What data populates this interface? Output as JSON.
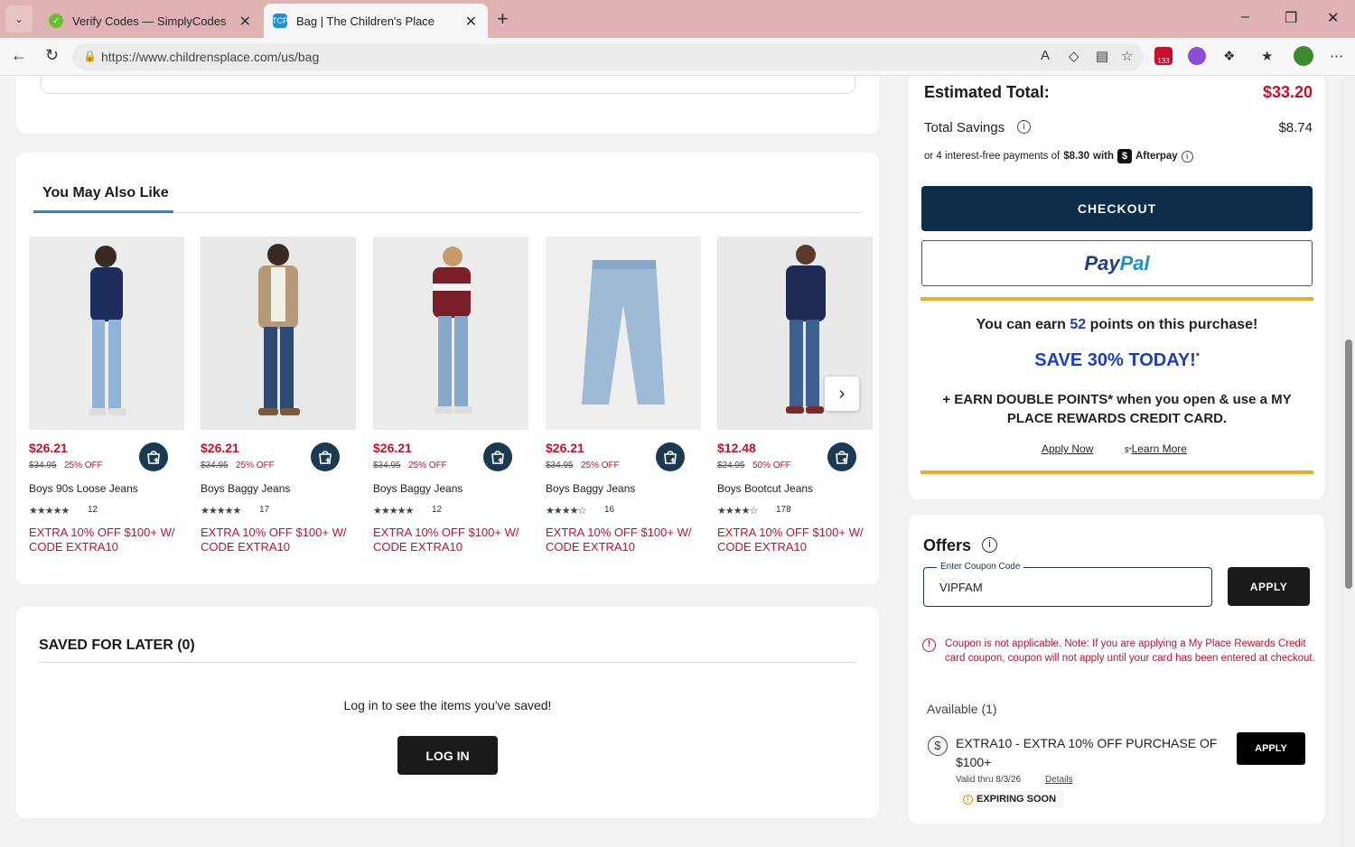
{
  "browser": {
    "tabs": [
      {
        "title": "Verify Codes — SimplyCodes",
        "active": false
      },
      {
        "title": "Bag | The Children's Place",
        "active": true
      }
    ],
    "tab2_favicon": "TCP",
    "url": "https://www.childrensplace.com/us/bag",
    "extension_badge": "133"
  },
  "ymal": {
    "title": "You May Also Like",
    "products": [
      {
        "price": "$26.21",
        "was": "$34.95",
        "off": "25% OFF",
        "name": "Boys 90s Loose Jeans",
        "rating": 5,
        "count": "12",
        "promo": "EXTRA 10% OFF $100+ W/ CODE EXTRA10"
      },
      {
        "price": "$26.21",
        "was": "$34.95",
        "off": "25% OFF",
        "name": "Boys Baggy Jeans",
        "rating": 5,
        "count": "17",
        "promo": "EXTRA 10% OFF $100+ W/ CODE EXTRA10"
      },
      {
        "price": "$26.21",
        "was": "$34.95",
        "off": "25% OFF",
        "name": "Boys Baggy Jeans",
        "rating": 4.5,
        "count": "12",
        "promo": "EXTRA 10% OFF $100+ W/ CODE EXTRA10"
      },
      {
        "price": "$26.21",
        "was": "$34.95",
        "off": "25% OFF",
        "name": "Boys Baggy Jeans",
        "rating": 4,
        "count": "16",
        "promo": "EXTRA 10% OFF $100+ W/ CODE EXTRA10"
      },
      {
        "price": "$12.48",
        "was": "$24.95",
        "off": "50% OFF",
        "name": "Boys Bootcut Jeans",
        "rating": 4,
        "count": "178",
        "promo": "EXTRA 10% OFF $100+ W/ CODE EXTRA10"
      }
    ]
  },
  "saved": {
    "title": "SAVED FOR LATER (0)",
    "message": "Log in to see the items you've saved!",
    "login_label": "LOG IN"
  },
  "summary": {
    "estimated_label": "Estimated Total:",
    "estimated_value": "$33.20",
    "savings_label": "Total Savings",
    "savings_value": "$8.74",
    "afterpay_prefix": "or 4 interest-free payments of",
    "afterpay_amount": "$8.30",
    "afterpay_with": "with",
    "afterpay_brand": "Afterpay",
    "checkout_label": "CHECKOUT",
    "paypal_part1": "Pay",
    "paypal_part2": "Pal",
    "earn_prefix": "You can earn",
    "earn_points": "52",
    "earn_suffix": "points on this purchase!",
    "save_today": "SAVE 30% TODAY!",
    "save_today_mark": "*",
    "double_points": "+ EARN DOUBLE POINTS* when you open & use a MY PLACE REWARDS CREDIT CARD.",
    "apply_now": "Apply Now",
    "learn_more_prefix": "$*",
    "learn_more": "Learn More"
  },
  "offers": {
    "title": "Offers",
    "coupon_label": "Enter Coupon Code",
    "coupon_value": "VIPFAM",
    "apply_label": "APPLY",
    "error": "Coupon is not applicable. Note: If you are applying a My Place Rewards Credit card coupon, coupon will not apply until your card has been entered at checkout.",
    "available": "Available (1)",
    "offer_name": "EXTRA10 - EXTRA 10% OFF PURCHASE OF $100+",
    "offer_valid": "Valid thru 8/3/26",
    "offer_details": "Details",
    "offer_apply": "APPLY",
    "expiring": "EXPIRING SOON"
  },
  "colors": {
    "accent_red": "#c8102e",
    "navy": "#0d2b4a",
    "points_blue": "#1a3ccf",
    "rewards_orange": "#f5a623"
  }
}
